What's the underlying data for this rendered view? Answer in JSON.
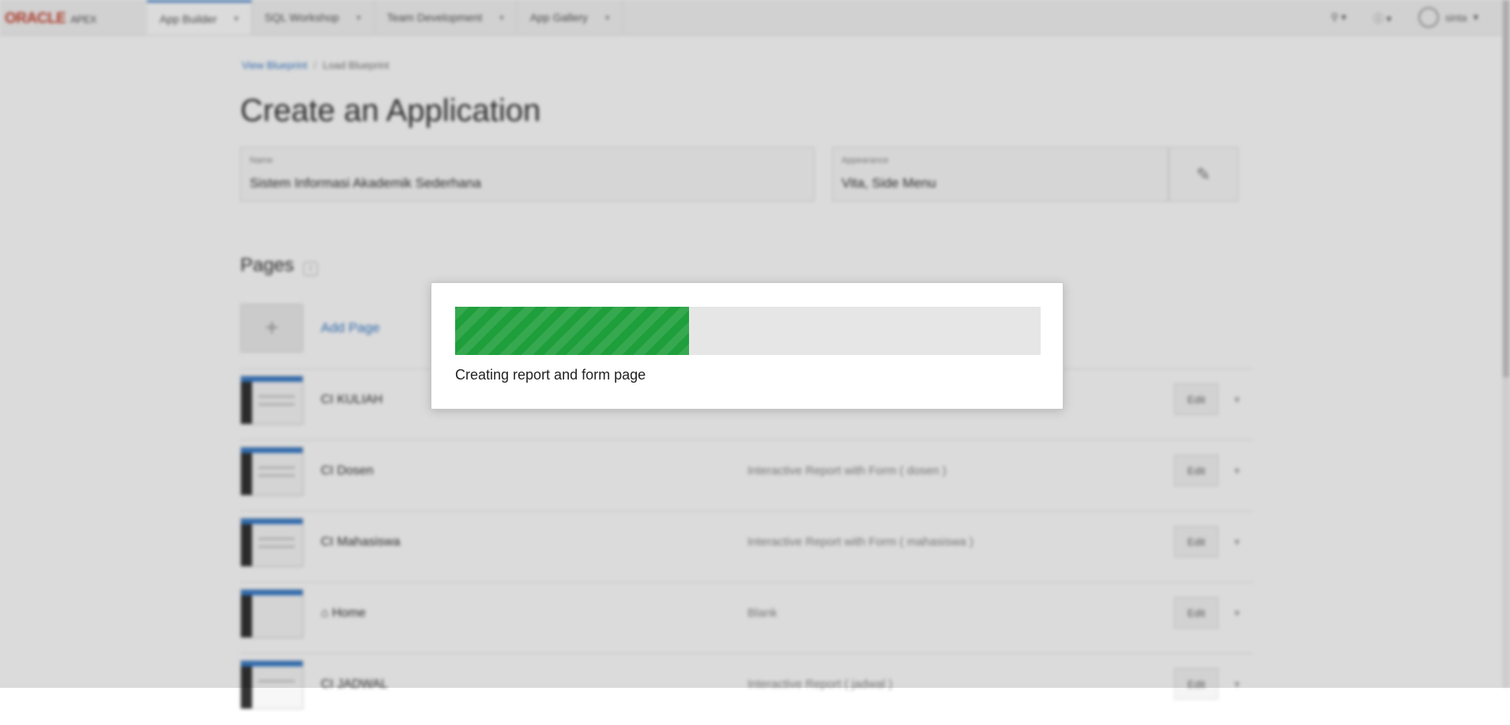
{
  "header": {
    "brand": "ORACLE",
    "product": "APEX",
    "tabs": [
      {
        "label": "App Builder",
        "active": true
      },
      {
        "label": "SQL Workshop",
        "active": false
      },
      {
        "label": "Team Development",
        "active": false
      },
      {
        "label": "App Gallery",
        "active": false
      }
    ],
    "user": "sinta"
  },
  "breadcrumb": {
    "link": "View Blueprint",
    "current": "Load Blueprint"
  },
  "page_title": "Create an Application",
  "form": {
    "name_label": "Name",
    "name_value": "Sistem Informasi Akademik Sederhana",
    "appearance_label": "Appearance",
    "appearance_value": "Vita, Side Menu"
  },
  "pages_section": {
    "title": "Pages",
    "add_label": "Add Page",
    "rows": [
      {
        "name": "CI KULIAH",
        "type": "",
        "edit": "Edit"
      },
      {
        "name": "CI Dosen",
        "type": "Interactive Report with Form ( dosen )",
        "edit": "Edit"
      },
      {
        "name": "CI Mahasiswa",
        "type": "Interactive Report with Form ( mahasiswa )",
        "edit": "Edit"
      },
      {
        "name": "Home",
        "type": "Blank",
        "edit": "Edit"
      },
      {
        "name": "CI JADWAL",
        "type": "Interactive Report ( jadwal )",
        "edit": "Edit"
      }
    ]
  },
  "progress": {
    "percent": 40,
    "message": "Creating report and form page",
    "color": "#1f9f3c"
  }
}
